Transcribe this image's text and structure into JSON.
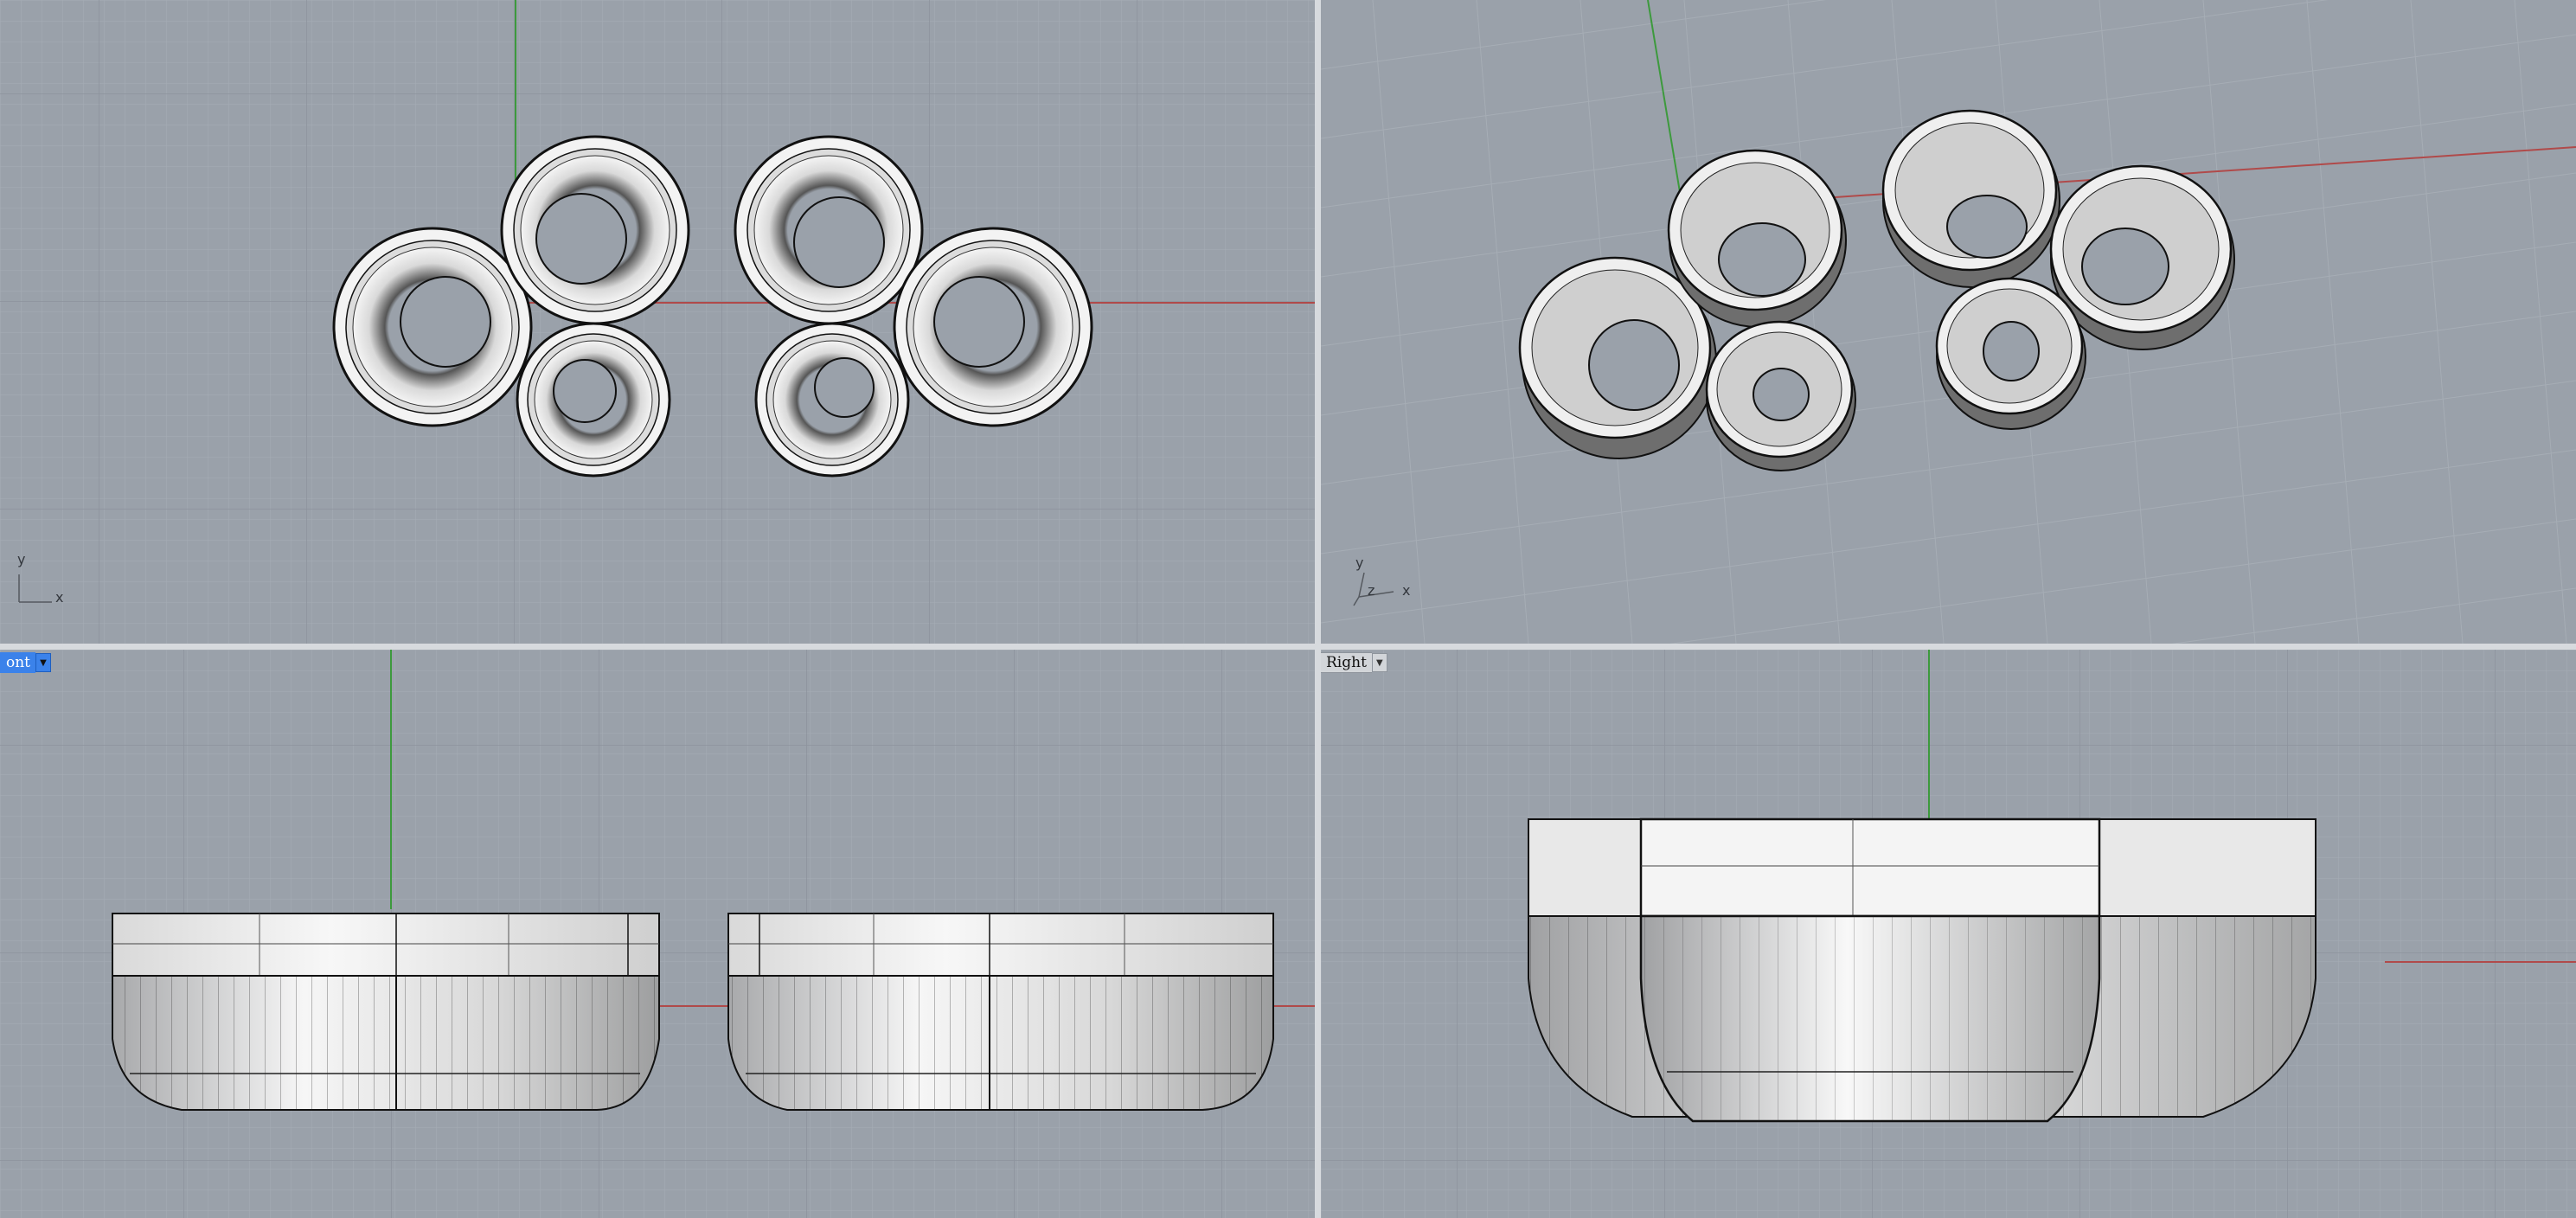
{
  "viewports": {
    "top": {
      "axis_y": "y",
      "axis_x": "x"
    },
    "perspective": {
      "axis_y": "y",
      "axis_z": "z",
      "axis_x": "x"
    },
    "front": {
      "tab_label": "ont",
      "dropdown_icon": "triangle-down-icon"
    },
    "right": {
      "tab_label": "Right",
      "dropdown_icon": "triangle-down-icon"
    }
  },
  "colors": {
    "viewport_bg": "#9aa1aa",
    "grid_minor": "#a4abb3",
    "grid_major": "#8c939c",
    "x_axis": "#b04a4a",
    "y_axis": "#3d9a3d",
    "active_tab": "#3b82ea",
    "surface_light": "#f2f2f2",
    "surface_shade": "#bfc0c2"
  }
}
